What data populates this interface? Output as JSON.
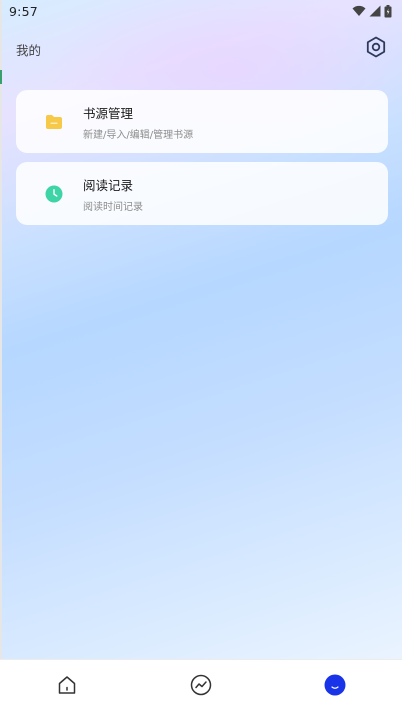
{
  "status_bar": {
    "time": "9:57",
    "icons": [
      "wifi-icon",
      "signal-icon",
      "battery-icon"
    ]
  },
  "header": {
    "title": "我的",
    "settings_icon": "hexagon-settings-icon"
  },
  "cards": [
    {
      "title": "书源管理",
      "subtitle": "新建/导入/编辑/管理书源",
      "icon": "folder-icon",
      "icon_color": "#f7c948"
    },
    {
      "title": "阅读记录",
      "subtitle": "阅读时间记录",
      "icon": "clock-icon",
      "icon_color": "#3ed4a6"
    }
  ],
  "bottom_nav": {
    "items": [
      {
        "icon": "home-icon",
        "active": false
      },
      {
        "icon": "trend-icon",
        "active": false
      },
      {
        "icon": "profile-icon",
        "active": true,
        "color": "#1833e8"
      }
    ]
  }
}
